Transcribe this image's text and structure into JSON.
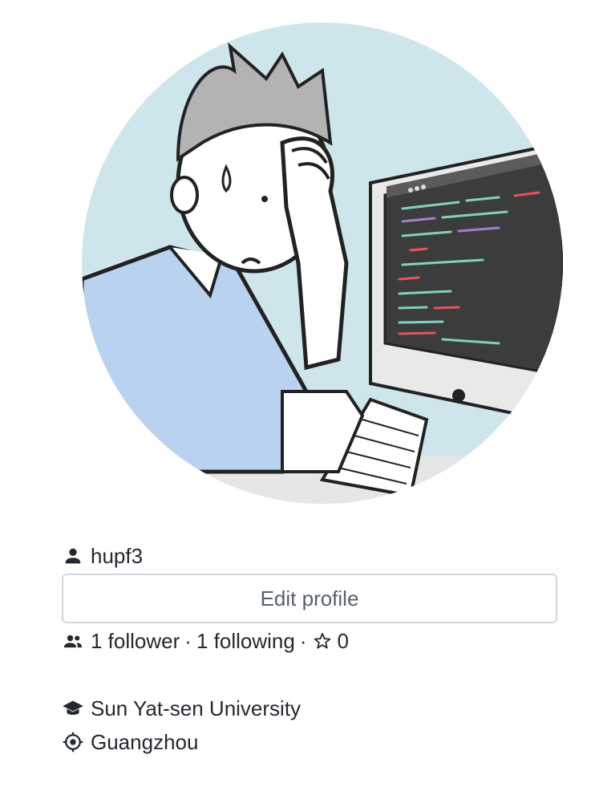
{
  "profile": {
    "username": "hupf3",
    "edit_label": "Edit profile",
    "followers_label": "1 follower",
    "following_label": "1 following",
    "stars_count": "0",
    "separator": "·",
    "organization": "Sun Yat-sen University",
    "location": "Guangzhou"
  },
  "icons": {
    "person": "person-icon",
    "people": "people-icon",
    "star": "star-icon",
    "org": "graduation-cap-icon",
    "location": "location-icon"
  },
  "colors": {
    "text": "#24292f",
    "muted": "#57606a",
    "border": "#d0d7de",
    "avatar_bg": "#cfe5ec"
  }
}
